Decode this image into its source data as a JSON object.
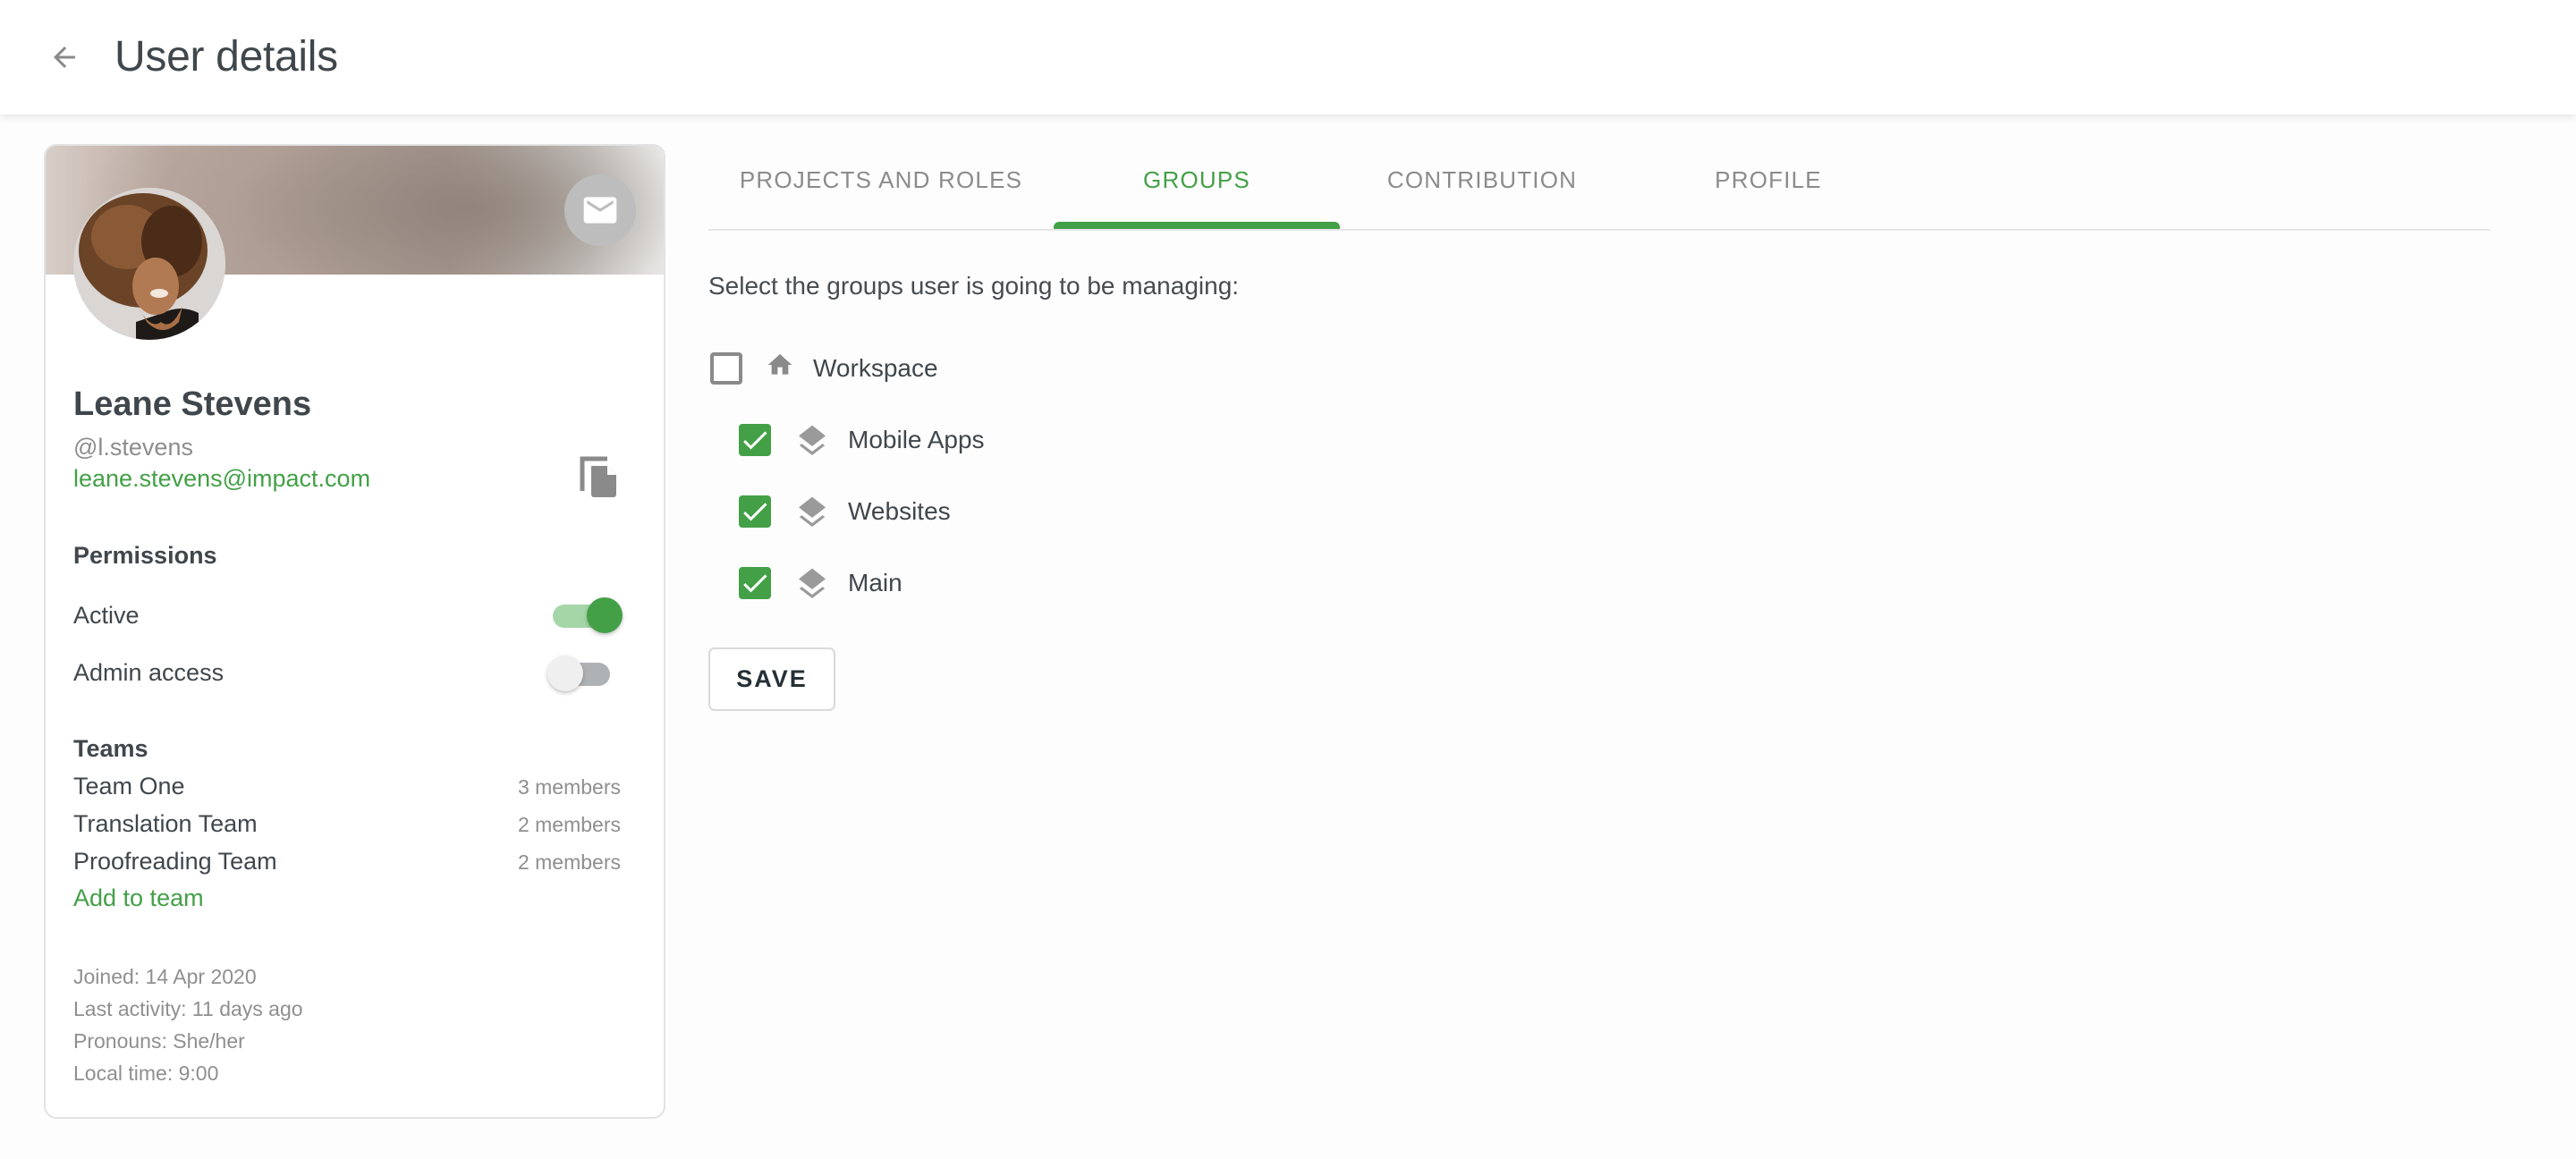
{
  "header": {
    "title": "User details",
    "back_icon": "arrow-back-icon"
  },
  "profile": {
    "name": "Leane Stevens",
    "username": "@l.stevens",
    "email": "leane.stevens@impact.com",
    "avatar_alt": "Leane Stevens avatar",
    "mail_icon": "mail-icon",
    "copy_icon": "copy-icon",
    "permissions": {
      "title": "Permissions",
      "items": [
        {
          "label": "Active",
          "enabled": true
        },
        {
          "label": "Admin access",
          "enabled": false
        }
      ]
    },
    "teams": {
      "title": "Teams",
      "items": [
        {
          "name": "Team One",
          "members": "3 members"
        },
        {
          "name": "Translation Team",
          "members": "2 members"
        },
        {
          "name": "Proofreading Team",
          "members": "2 members"
        }
      ],
      "add_label": "Add to team"
    },
    "meta": [
      "Joined: 14 Apr 2020",
      "Last activity: 11 days ago",
      "Pronouns: She/her",
      "Local time: 9:00"
    ]
  },
  "tabs": [
    {
      "label": "PROJECTS AND ROLES",
      "active": false
    },
    {
      "label": "GROUPS",
      "active": true
    },
    {
      "label": "CONTRIBUTION",
      "active": false
    },
    {
      "label": "PROFILE",
      "active": false
    }
  ],
  "groups": {
    "instruction": "Select the groups user is going to be managing:",
    "items": [
      {
        "label": "Workspace",
        "icon": "home-icon",
        "checked": false,
        "level": 0
      },
      {
        "label": "Mobile Apps",
        "icon": "layers-icon",
        "checked": true,
        "level": 1
      },
      {
        "label": "Websites",
        "icon": "layers-icon",
        "checked": true,
        "level": 1
      },
      {
        "label": "Main",
        "icon": "layers-icon",
        "checked": true,
        "level": 1
      }
    ],
    "save_label": "SAVE"
  },
  "colors": {
    "accent": "#43a047",
    "text": "#40474c",
    "muted": "#8f8f8f"
  }
}
